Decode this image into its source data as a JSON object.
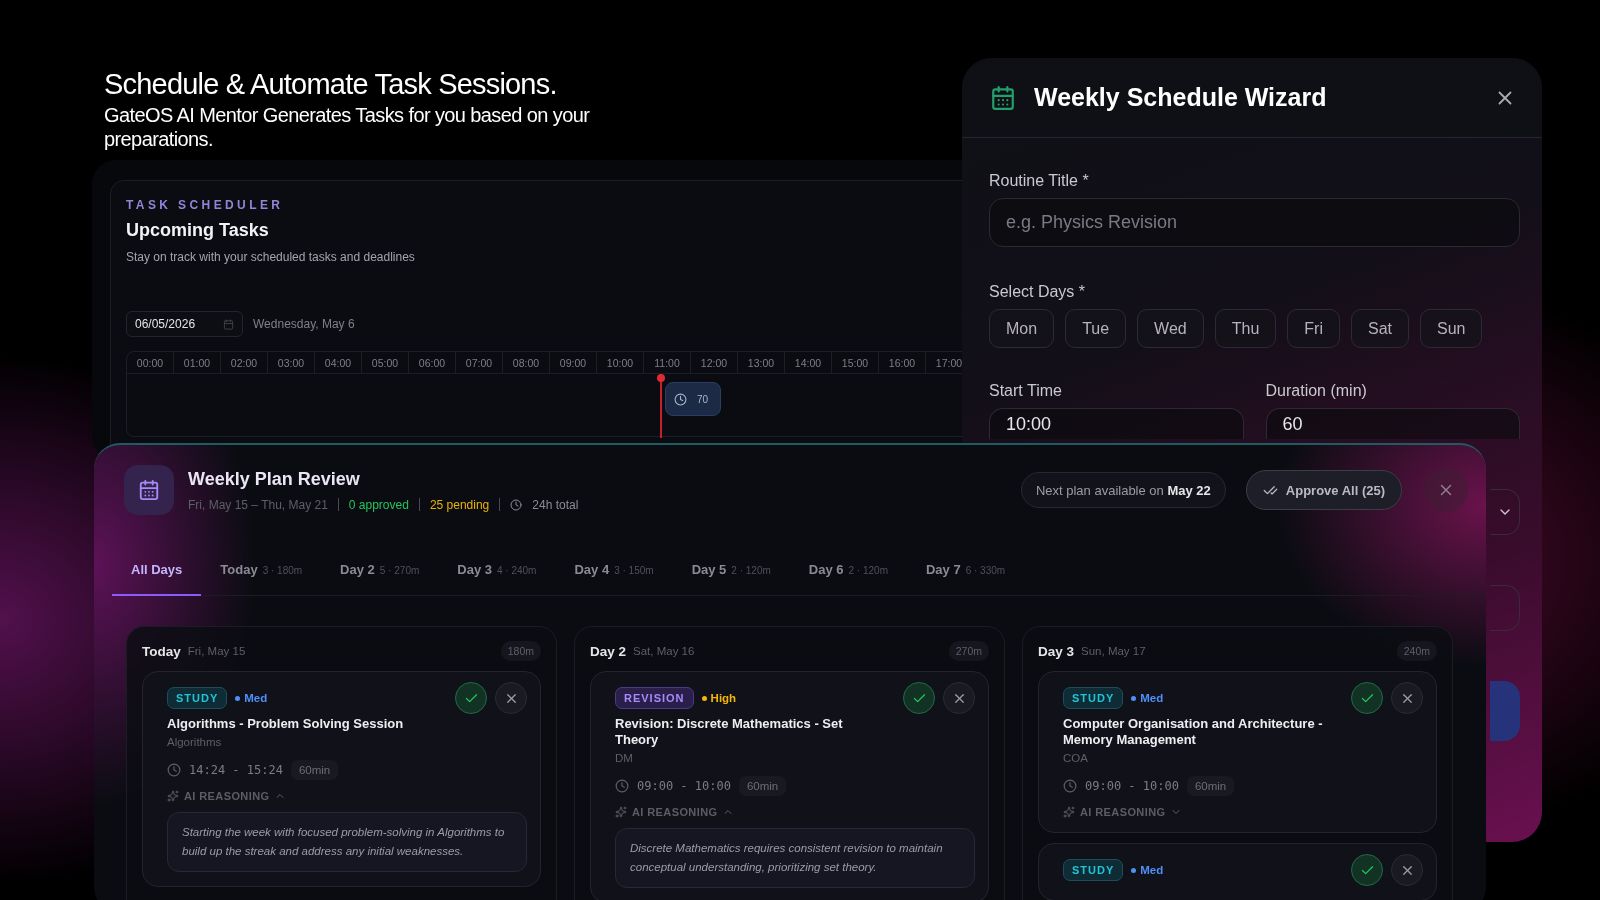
{
  "hero": {
    "title": "Schedule & Automate Task Sessions.",
    "subtitle": "GateOS AI Mentor Generates Tasks for you based on your preparations."
  },
  "scheduler": {
    "eyebrow": "TASK SCHEDULER",
    "title": "Upcoming Tasks",
    "subtitle": "Stay on track with your scheduled tasks and deadlines",
    "date_value": "06/05/2026",
    "date_label": "Wednesday, May 6",
    "hours": [
      "00:00",
      "01:00",
      "02:00",
      "03:00",
      "04:00",
      "05:00",
      "06:00",
      "07:00",
      "08:00",
      "09:00",
      "10:00",
      "11:00",
      "12:00",
      "13:00",
      "14:00",
      "15:00",
      "16:00",
      "17:00"
    ],
    "task_block": {
      "label": "70"
    }
  },
  "wizard": {
    "title": "Weekly Schedule Wizard",
    "routine_label": "Routine Title *",
    "routine_placeholder": "e.g. Physics Revision",
    "days_label": "Select Days *",
    "days": [
      {
        "label": "Mon",
        "selected": false
      },
      {
        "label": "Tue",
        "selected": false
      },
      {
        "label": "Wed",
        "selected": false
      },
      {
        "label": "Thu",
        "selected": false
      },
      {
        "label": "Fri",
        "selected": false
      },
      {
        "label": "Sat",
        "selected": false
      },
      {
        "label": "Sun",
        "selected": false
      }
    ],
    "start_label": "Start Time",
    "start_value": "10:00",
    "duration_label": "Duration (min)",
    "duration_value": "60"
  },
  "review": {
    "title": "Weekly Plan Review",
    "range": "Fri, May 15 – Thu, May 21",
    "approved": "0 approved",
    "pending": "25 pending",
    "total": "24h total",
    "next_plan": "Next plan available on **May 22**",
    "approve_all": "Approve All (25)",
    "tabs": [
      {
        "label": "All Days",
        "selected": true
      },
      {
        "label": "Today",
        "meta": "3 · 180m",
        "selected": false
      },
      {
        "label": "Day 2",
        "meta": "5 · 270m",
        "selected": false
      },
      {
        "label": "Day 3",
        "meta": "4 · 240m",
        "selected": false
      },
      {
        "label": "Day 4",
        "meta": "3 · 150m",
        "selected": false
      },
      {
        "label": "Day 5",
        "meta": "2 · 120m",
        "selected": false
      },
      {
        "label": "Day 6",
        "meta": "2 · 120m",
        "selected": false
      },
      {
        "label": "Day 7",
        "meta": "6 · 330m",
        "selected": false
      }
    ],
    "days": [
      {
        "name": "Today",
        "date": "Fri, May 15",
        "total": "180m",
        "tasks": [
          {
            "kind": "study",
            "tag": "STUDY",
            "priority": {
              "kind": "med",
              "label": "Med"
            },
            "title": "Algorithms - Problem Solving Session",
            "subject": "Algorithms",
            "time": "14:24 - 15:24",
            "duration": "60min",
            "reasoning_label": "AI REASONING",
            "expanded": true,
            "reasoning": "Starting the week with focused problem-solving in Algorithms to build up the streak and address any initial weaknesses."
          }
        ]
      },
      {
        "name": "Day 2",
        "date": "Sat, May 16",
        "total": "270m",
        "tasks": [
          {
            "kind": "revision",
            "tag": "REVISION",
            "priority": {
              "kind": "high",
              "label": "High"
            },
            "title": "Revision: Discrete Mathematics - Set Theory",
            "subject": "DM",
            "time": "09:00 - 10:00",
            "duration": "60min",
            "reasoning_label": "AI REASONING",
            "expanded": true,
            "reasoning": "Discrete Mathematics requires consistent revision to maintain conceptual understanding, prioritizing set theory."
          }
        ]
      },
      {
        "name": "Day 3",
        "date": "Sun, May 17",
        "total": "240m",
        "tasks": [
          {
            "kind": "study",
            "tag": "STUDY",
            "priority": {
              "kind": "med",
              "label": "Med"
            },
            "title": "Computer Organisation and Architecture - Memory Management",
            "subject": "COA",
            "time": "09:00 - 10:00",
            "duration": "60min",
            "reasoning_label": "AI REASONING",
            "expanded": false
          },
          {
            "kind": "study",
            "tag": "STUDY",
            "priority": {
              "kind": "med",
              "label": "Med"
            }
          }
        ]
      }
    ]
  }
}
